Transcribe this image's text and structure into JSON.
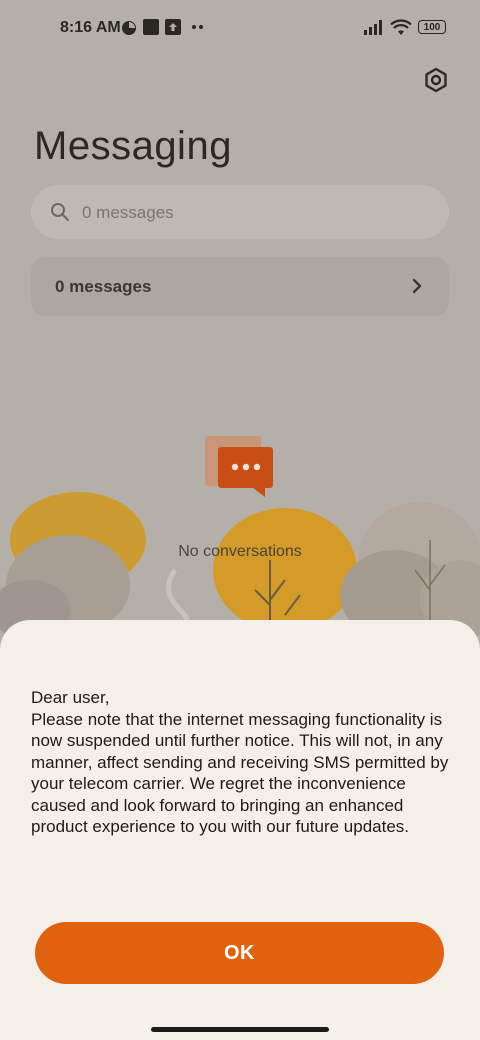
{
  "status_bar": {
    "time": "8:16 AM",
    "battery": "100"
  },
  "header": {
    "title": "Messaging"
  },
  "search": {
    "placeholder": "0 messages"
  },
  "messages_row": {
    "label": "0 messages"
  },
  "empty_state": {
    "label": "No conversations"
  },
  "dialog": {
    "message": "Dear user,\nPlease note that the internet messaging functionality is now suspended until further notice. This will not, in any manner, affect sending and receiving SMS permitted by your telecom carrier. We regret the inconvenience caused and look forward to bringing an enhanced product experience to you with our future updates.",
    "ok_label": "OK"
  },
  "colors": {
    "accent": "#e0620f",
    "sheet_bg": "#f4efe9",
    "scrim_bg": "#b4b0a9"
  },
  "icons": [
    "settings-icon",
    "search-icon",
    "chevron-right-icon",
    "chat-bubble-icon",
    "wifi-icon",
    "signal-icon",
    "battery-icon"
  ]
}
